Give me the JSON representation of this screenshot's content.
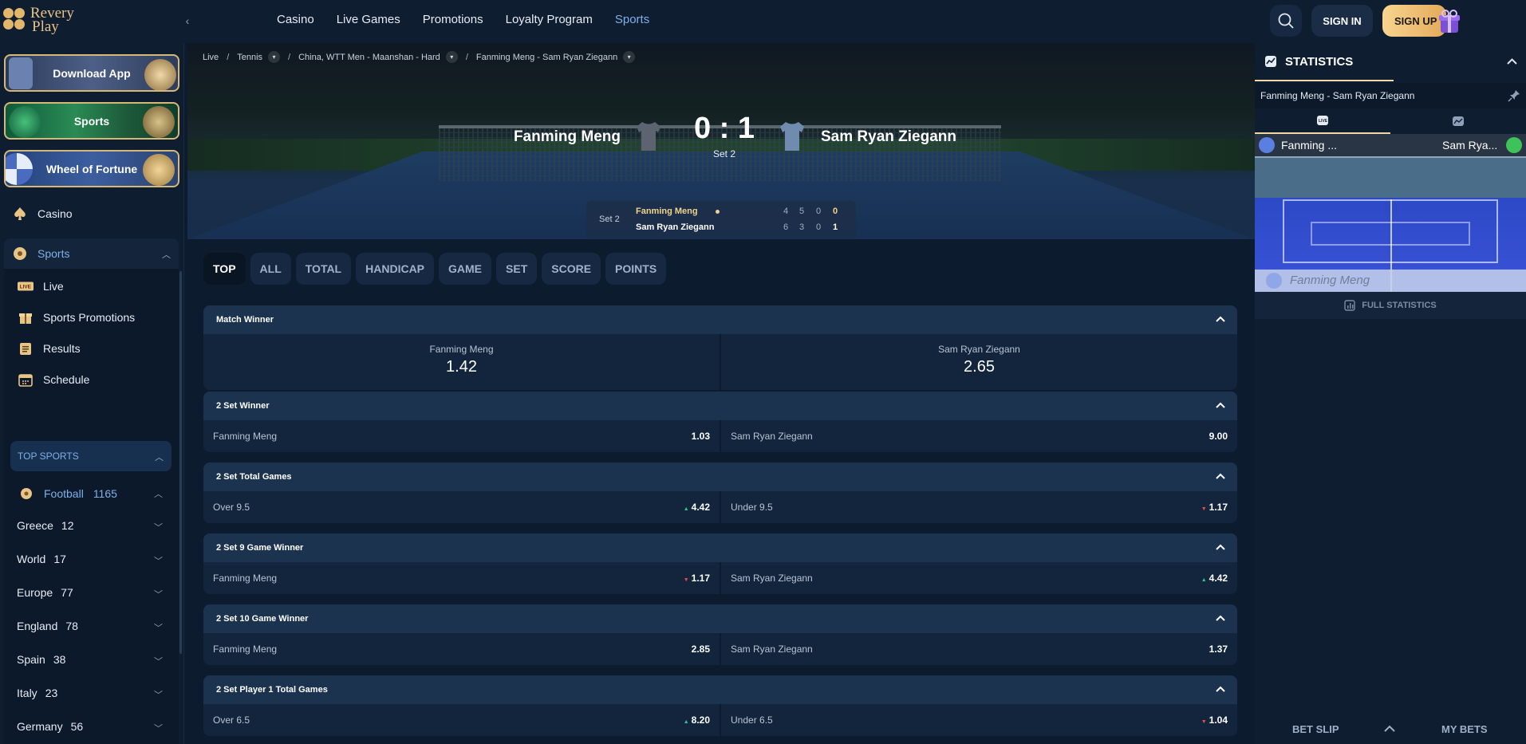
{
  "brand": {
    "line1": "Revery",
    "line2": "Play"
  },
  "topnav": [
    {
      "label": "Casino"
    },
    {
      "label": "Live Games"
    },
    {
      "label": "Promotions"
    },
    {
      "label": "Loyalty Program"
    },
    {
      "label": "Sports",
      "active": true
    }
  ],
  "header": {
    "signin": "SIGN IN",
    "signup": "SIGN UP"
  },
  "sidebar": {
    "promos": [
      "Download App",
      "Sports",
      "Wheel of Fortune"
    ],
    "casino": "Casino",
    "sports": "Sports",
    "sub": [
      "Live",
      "Sports Promotions",
      "Results",
      "Schedule"
    ],
    "top_sports": "TOP SPORTS",
    "football": {
      "label": "Football",
      "count": "1165"
    },
    "leagues": [
      {
        "name": "Greece",
        "count": "12"
      },
      {
        "name": "World",
        "count": "17"
      },
      {
        "name": "Europe",
        "count": "77"
      },
      {
        "name": "England",
        "count": "78"
      },
      {
        "name": "Spain",
        "count": "38"
      },
      {
        "name": "Italy",
        "count": "23"
      },
      {
        "name": "Germany",
        "count": "56"
      }
    ]
  },
  "breadcrumb": [
    "Live",
    "Tennis",
    "China, WTT Men - Maanshan - Hard",
    "Fanming Meng - Sam Ryan Ziegann"
  ],
  "match": {
    "player1": "Fanming Meng",
    "player2": "Sam Ryan Ziegann",
    "score": "0 : 1",
    "set": "Set 2",
    "board": {
      "set_label": "Set 2",
      "p1": {
        "name": "Fanming Meng",
        "games": [
          "4",
          "5",
          "0"
        ],
        "points": "0"
      },
      "p2": {
        "name": "Sam Ryan Ziegann",
        "games": [
          "6",
          "3",
          "0"
        ],
        "points": "1"
      }
    }
  },
  "tabs": [
    "TOP",
    "ALL",
    "TOTAL",
    "HANDICAP",
    "GAME",
    "SET",
    "SCORE",
    "POINTS"
  ],
  "markets": [
    {
      "title": "Match Winner",
      "big": true,
      "left": {
        "label": "Fanming Meng",
        "odd": "1.42"
      },
      "right": {
        "label": "Sam Ryan Ziegann",
        "odd": "2.65"
      }
    },
    {
      "title": "2 Set Winner",
      "left": {
        "label": "Fanming Meng",
        "odd": "1.03",
        "trend": ""
      },
      "right": {
        "label": "Sam Ryan Ziegann",
        "odd": "9.00",
        "trend": ""
      }
    },
    {
      "title": "2 Set Total Games",
      "left": {
        "label": "Over 9.5",
        "odd": "4.42",
        "trend": "up"
      },
      "right": {
        "label": "Under 9.5",
        "odd": "1.17",
        "trend": "down"
      }
    },
    {
      "title": "2 Set 9 Game Winner",
      "left": {
        "label": "Fanming Meng",
        "odd": "1.17",
        "trend": "down"
      },
      "right": {
        "label": "Sam Ryan Ziegann",
        "odd": "4.42",
        "trend": "up"
      }
    },
    {
      "title": "2 Set 10 Game Winner",
      "left": {
        "label": "Fanming Meng",
        "odd": "2.85",
        "trend": ""
      },
      "right": {
        "label": "Sam Ryan Ziegann",
        "odd": "1.37",
        "trend": ""
      }
    },
    {
      "title": "2 Set Player 1 Total Games",
      "left": {
        "label": "Over 6.5",
        "odd": "8.20",
        "trend": "up"
      },
      "right": {
        "label": "Under 6.5",
        "odd": "1.04",
        "trend": "down"
      }
    }
  ],
  "stats": {
    "title": "STATISTICS",
    "match": "Fanming Meng - Sam Ryan Ziegann",
    "tracker_p1": "Fanming ...",
    "tracker_p2": "Sam Rya...",
    "tracker_server": "Fanming Meng",
    "full": "FULL STATISTICS"
  },
  "betslip": {
    "slip": "BET SLIP",
    "mybets": "MY BETS"
  },
  "colors": {
    "accent": "#7fb0e8",
    "gold": "#e8c486",
    "up": "#31c48d",
    "down": "#ef4b4b"
  }
}
